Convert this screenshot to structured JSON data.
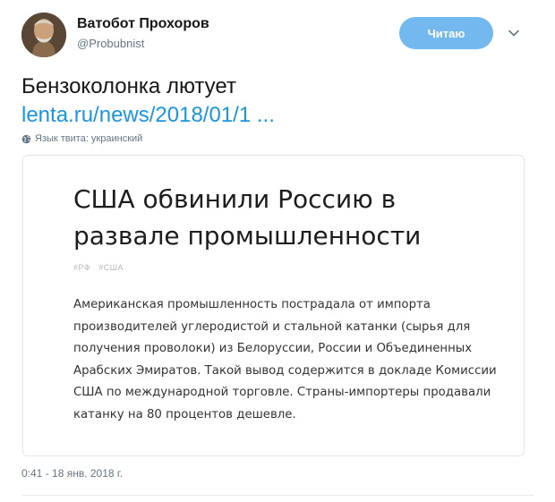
{
  "author": {
    "display_name": "Ватобот Прохоров",
    "screen_name": "@Probubnist"
  },
  "follow_button": {
    "label": "Читаю",
    "color": "#73b9ef"
  },
  "tweet": {
    "text": "Бензоколонка лютует",
    "link": "lenta.ru/news/2018/01/1 ...",
    "language_line": "Язык твита: украинский"
  },
  "card": {
    "title": "США обвинили Россию в развале промышленности",
    "tags": [
      "#РФ",
      "#США"
    ],
    "body": "Американская промышленность пострадала от импорта производителей углеродистой и стальной катанки (сырья для получения проволоки) из Белоруссии, России и Объединенных Арабских Эмиратов. Такой вывод содержится в докладе Комиссии США по международной торговле. Страны-импортеры продавали катанку на 80 процентов дешевле."
  },
  "timestamp": "0:41 - 18 янв. 2018 г.",
  "colors": {
    "link": "#1b95e0",
    "secondary_text": "#657786",
    "border": "#e1e8ed"
  },
  "icons": {
    "caret": "chevron-down-icon",
    "language": "globe-icon"
  }
}
